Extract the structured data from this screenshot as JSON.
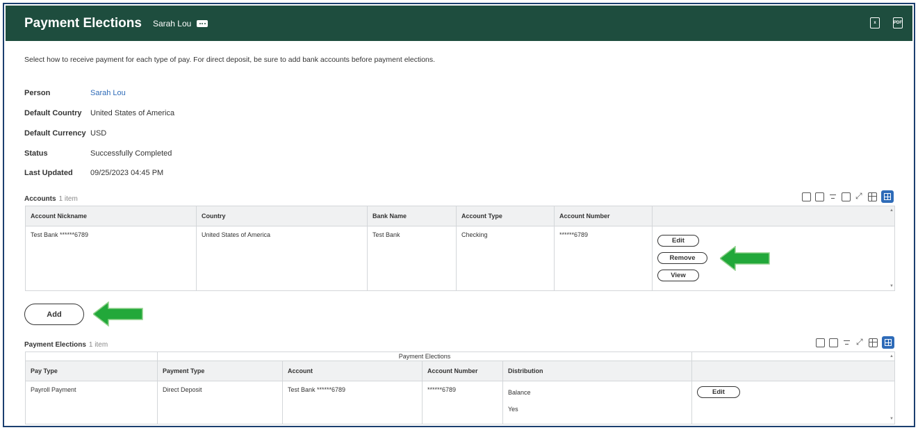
{
  "header": {
    "title": "Payment Elections",
    "person": "Sarah Lou",
    "excel_icon_text": "x",
    "pdf_icon_text": "PDF"
  },
  "instructions": "Select how to receive payment for each type of pay. For direct deposit, be sure to add bank accounts before payment elections.",
  "fields": [
    {
      "label": "Person",
      "value": "Sarah Lou"
    },
    {
      "label": "Default Country",
      "value": "United States of America"
    },
    {
      "label": "Default Currency",
      "value": "USD"
    },
    {
      "label": "Status",
      "value": "Successfully Completed"
    },
    {
      "label": "Last Updated",
      "value": "09/25/2023 04:45 PM"
    }
  ],
  "accounts": {
    "title": "Accounts",
    "count": "1 item",
    "columns": [
      "Account Nickname",
      "Country",
      "Bank Name",
      "Account Type",
      "Account Number",
      ""
    ],
    "rows": [
      {
        "nickname": "Test Bank ******6789",
        "country": "United States of America",
        "bank": "Test Bank",
        "type": "Checking",
        "number": "******6789"
      }
    ],
    "buttons": {
      "edit": "Edit",
      "remove": "Remove",
      "view": "View"
    },
    "add_label": "Add"
  },
  "payment_elections": {
    "title": "Payment Elections",
    "count": "1 item",
    "group_header": "Payment Elections",
    "columns": [
      "Pay Type",
      "Payment Type",
      "Account",
      "Account Number",
      "Distribution",
      ""
    ],
    "rows": [
      {
        "pay_type": "Payroll Payment",
        "payment_type": "Direct Deposit",
        "account": "Test Bank ******6789",
        "number": "******6789",
        "distribution": "Balance",
        "distribution_value": "Yes"
      }
    ],
    "edit_label": "Edit"
  },
  "colors": {
    "header_bg": "#1e4d3e",
    "link": "#2e6bb8",
    "arrow": "#22a83a",
    "frame_border": "#1b3f6f"
  }
}
